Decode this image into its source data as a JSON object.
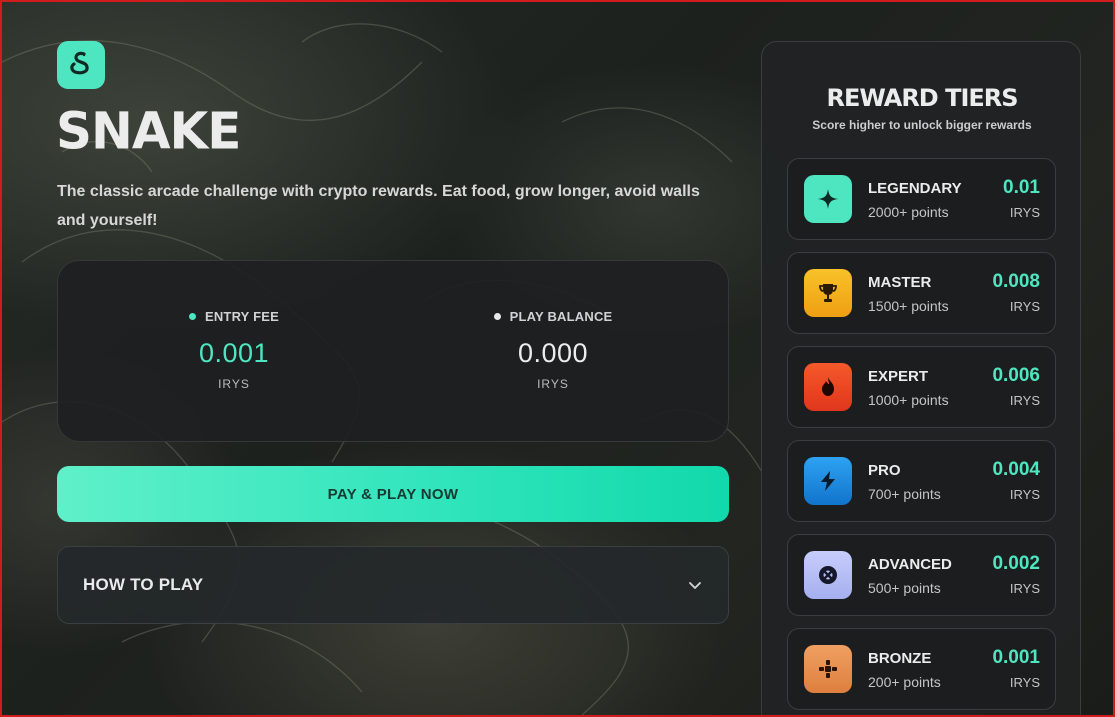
{
  "app": {
    "title": "SNAKE",
    "description": "The classic arcade challenge with crypto rewards. Eat food, grow longer, avoid walls and yourself!",
    "logo_icon": "snake-icon"
  },
  "stats": {
    "entry_fee": {
      "label": "ENTRY FEE",
      "value": "0.001",
      "unit": "IRYS",
      "dot_color": "#4ee6c0"
    },
    "play_balance": {
      "label": "PLAY BALANCE",
      "value": "0.000",
      "unit": "IRYS",
      "dot_color": "#e8e8e8"
    }
  },
  "play_button": {
    "label": "PAY & PLAY NOW"
  },
  "how_to_play": {
    "label": "HOW TO PLAY",
    "icon": "chevron-down-icon"
  },
  "reward_tiers": {
    "title": "REWARD TIERS",
    "subtitle": "Score higher to unlock bigger rewards",
    "tiers": [
      {
        "name": "LEGENDARY",
        "points": "2000+ points",
        "reward": "0.01",
        "unit": "IRYS",
        "icon": "sparkle-icon",
        "color": "#4ee6c0"
      },
      {
        "name": "MASTER",
        "points": "1500+ points",
        "reward": "0.008",
        "unit": "IRYS",
        "icon": "trophy-icon",
        "color": "#f5b21a"
      },
      {
        "name": "EXPERT",
        "points": "1000+ points",
        "reward": "0.006",
        "unit": "IRYS",
        "icon": "fire-icon",
        "color": "#ef4a23"
      },
      {
        "name": "PRO",
        "points": "700+ points",
        "reward": "0.004",
        "unit": "IRYS",
        "icon": "lightning-icon",
        "color": "#1d8fe6"
      },
      {
        "name": "ADVANCED",
        "points": "500+ points",
        "reward": "0.002",
        "unit": "IRYS",
        "icon": "target-icon",
        "color": "#b7bff5"
      },
      {
        "name": "BRONZE",
        "points": "200+ points",
        "reward": "0.001",
        "unit": "IRYS",
        "icon": "gamepad-icon",
        "color": "#e8914f"
      }
    ]
  }
}
